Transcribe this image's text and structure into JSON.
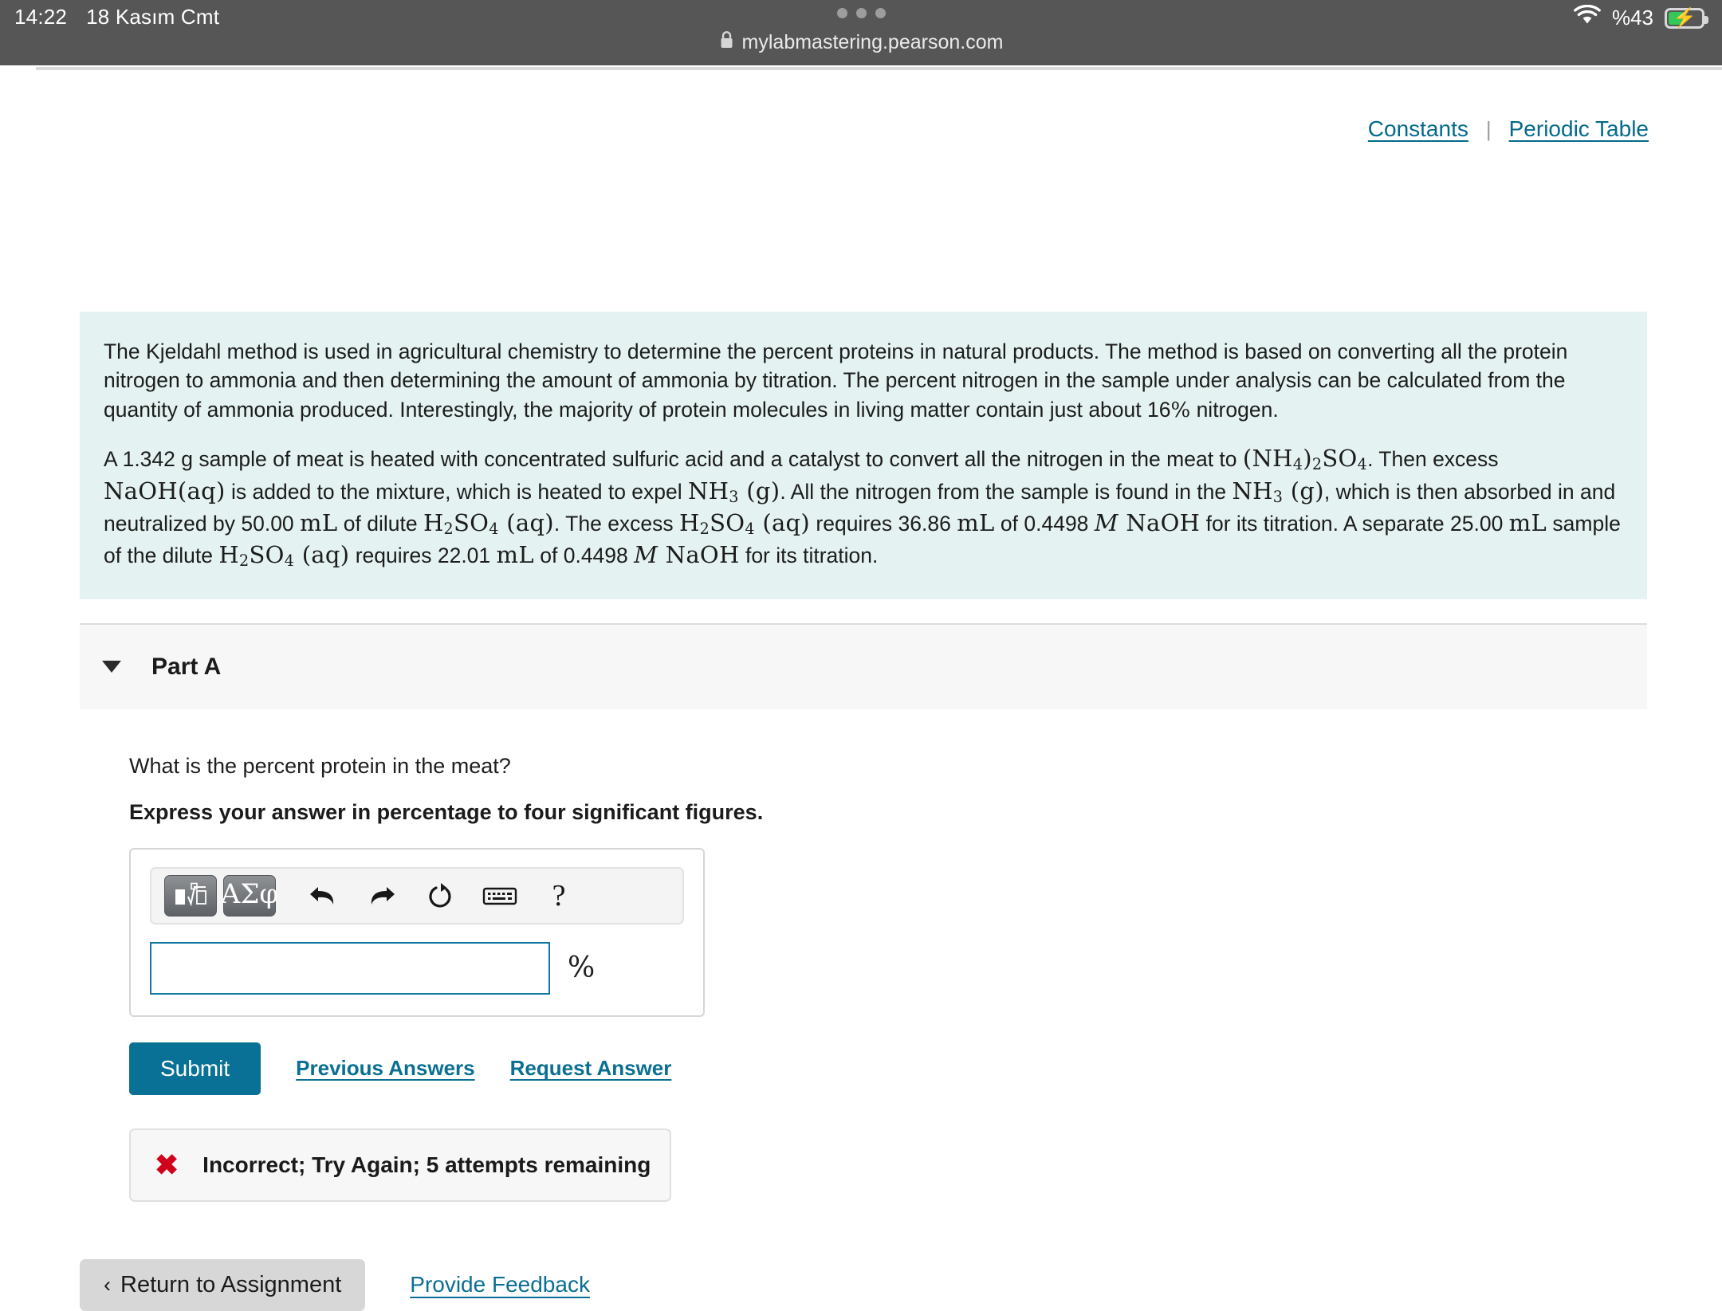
{
  "status_bar": {
    "time": "14:22",
    "date": "18 Kasım Cmt",
    "battery_label": "%43",
    "wifi_icon": "wifi-icon",
    "battery_icon": "battery-charging-icon"
  },
  "browser": {
    "url": "mylabmastering.pearson.com",
    "lock_icon": "lock-icon",
    "tab_dots": "tab-overview-dots"
  },
  "toolbar_links": {
    "constants": "Constants",
    "separator": "|",
    "periodic_table": "Periodic Table"
  },
  "problem": {
    "paragraph1_a": "The Kjeldahl method is used in agricultural chemistry to determine the percent proteins in natural products. The method is based on converting all the protein nitrogen to ammonia and then determining the amount of ammonia by titration. The percent nitrogen in the sample under analysis can be calculated from the quantity of ammonia produced. Interestingly, the majority of protein molecules in living matter contain just about 16",
    "paragraph1_pct": "%",
    "paragraph1_b": " nitrogen.",
    "p2_s1": "A 1.342 g sample of meat is heated with concentrated sulfuric acid and a catalyst to convert all the nitrogen in the meat to ",
    "p2_f1": "(NH4)2SO4",
    "p2_s2": ". Then excess ",
    "p2_f2": "NaOH(aq)",
    "p2_s3": " is added to the mixture, which is heated to expel ",
    "p2_f3": "NH3 (g)",
    "p2_s4": ". All the nitrogen from the sample is found in the ",
    "p2_f4": "NH3 (g)",
    "p2_s5": ", which is then absorbed in and neutralized by 50.00 ",
    "p2_f5": "mL",
    "p2_s6": " of dilute ",
    "p2_f6": "H2SO4 (aq)",
    "p2_s7": ". The excess ",
    "p2_f7": "H2SO4 (aq)",
    "p2_s8": " requires 36.86 ",
    "p2_f8": "mL",
    "p2_s9": " of 0.4498 ",
    "p2_f9": "M NaOH",
    "p2_s10": " for its titration. A separate 25.00 ",
    "p2_f10": "mL",
    "p2_s11": " sample of the dilute ",
    "p2_f11": "H2SO4 (aq)",
    "p2_s12": " requires 22.01 ",
    "p2_f12": "mL",
    "p2_s13": " of 0.4498 ",
    "p2_f13": "M NaOH",
    "p2_s14": " for its titration."
  },
  "part": {
    "title": "Part A",
    "caret_icon": "caret-down-icon",
    "question": "What is the percent protein in the meat?",
    "instruction": "Express your answer in percentage to four significant figures."
  },
  "math_toolbar": {
    "template_button": "template-math-icon",
    "greek_button": "ΑΣφ",
    "undo_icon": "undo-arrow-icon",
    "redo_icon": "redo-arrow-icon",
    "reset_icon": "reset-circular-arrow-icon",
    "keyboard_icon": "keyboard-icon",
    "help_label": "?"
  },
  "answer": {
    "value": "",
    "placeholder": "",
    "unit": "%"
  },
  "actions": {
    "submit_label": "Submit",
    "previous_answers_label": "Previous Answers",
    "request_answer_label": "Request Answer"
  },
  "feedback": {
    "icon": "x-mark-icon",
    "mark": "✖",
    "message": "Incorrect; Try Again; 5 attempts remaining"
  },
  "bottom": {
    "return_chevron": "‹",
    "return_label": "Return to Assignment",
    "provide_feedback_label": "Provide Feedback"
  },
  "colors": {
    "accent_teal": "#0a7196",
    "problem_bg": "#e4f3f1",
    "error_red": "#d0021b",
    "battery_green": "#34c759"
  }
}
